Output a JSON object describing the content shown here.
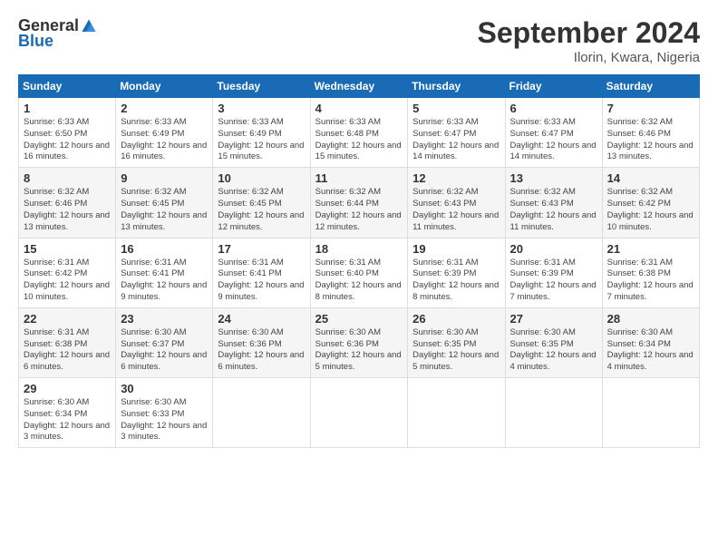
{
  "header": {
    "logo_general": "General",
    "logo_blue": "Blue",
    "title": "September 2024",
    "subtitle": "Ilorin, Kwara, Nigeria"
  },
  "weekdays": [
    "Sunday",
    "Monday",
    "Tuesday",
    "Wednesday",
    "Thursday",
    "Friday",
    "Saturday"
  ],
  "weeks": [
    [
      {
        "day": 1,
        "sunrise": "6:33 AM",
        "sunset": "6:50 PM",
        "daylight": "12 hours and 16 minutes."
      },
      {
        "day": 2,
        "sunrise": "6:33 AM",
        "sunset": "6:49 PM",
        "daylight": "12 hours and 16 minutes."
      },
      {
        "day": 3,
        "sunrise": "6:33 AM",
        "sunset": "6:49 PM",
        "daylight": "12 hours and 15 minutes."
      },
      {
        "day": 4,
        "sunrise": "6:33 AM",
        "sunset": "6:48 PM",
        "daylight": "12 hours and 15 minutes."
      },
      {
        "day": 5,
        "sunrise": "6:33 AM",
        "sunset": "6:47 PM",
        "daylight": "12 hours and 14 minutes."
      },
      {
        "day": 6,
        "sunrise": "6:33 AM",
        "sunset": "6:47 PM",
        "daylight": "12 hours and 14 minutes."
      },
      {
        "day": 7,
        "sunrise": "6:32 AM",
        "sunset": "6:46 PM",
        "daylight": "12 hours and 13 minutes."
      }
    ],
    [
      {
        "day": 8,
        "sunrise": "6:32 AM",
        "sunset": "6:46 PM",
        "daylight": "12 hours and 13 minutes."
      },
      {
        "day": 9,
        "sunrise": "6:32 AM",
        "sunset": "6:45 PM",
        "daylight": "12 hours and 13 minutes."
      },
      {
        "day": 10,
        "sunrise": "6:32 AM",
        "sunset": "6:45 PM",
        "daylight": "12 hours and 12 minutes."
      },
      {
        "day": 11,
        "sunrise": "6:32 AM",
        "sunset": "6:44 PM",
        "daylight": "12 hours and 12 minutes."
      },
      {
        "day": 12,
        "sunrise": "6:32 AM",
        "sunset": "6:43 PM",
        "daylight": "12 hours and 11 minutes."
      },
      {
        "day": 13,
        "sunrise": "6:32 AM",
        "sunset": "6:43 PM",
        "daylight": "12 hours and 11 minutes."
      },
      {
        "day": 14,
        "sunrise": "6:32 AM",
        "sunset": "6:42 PM",
        "daylight": "12 hours and 10 minutes."
      }
    ],
    [
      {
        "day": 15,
        "sunrise": "6:31 AM",
        "sunset": "6:42 PM",
        "daylight": "12 hours and 10 minutes."
      },
      {
        "day": 16,
        "sunrise": "6:31 AM",
        "sunset": "6:41 PM",
        "daylight": "12 hours and 9 minutes."
      },
      {
        "day": 17,
        "sunrise": "6:31 AM",
        "sunset": "6:41 PM",
        "daylight": "12 hours and 9 minutes."
      },
      {
        "day": 18,
        "sunrise": "6:31 AM",
        "sunset": "6:40 PM",
        "daylight": "12 hours and 8 minutes."
      },
      {
        "day": 19,
        "sunrise": "6:31 AM",
        "sunset": "6:39 PM",
        "daylight": "12 hours and 8 minutes."
      },
      {
        "day": 20,
        "sunrise": "6:31 AM",
        "sunset": "6:39 PM",
        "daylight": "12 hours and 7 minutes."
      },
      {
        "day": 21,
        "sunrise": "6:31 AM",
        "sunset": "6:38 PM",
        "daylight": "12 hours and 7 minutes."
      }
    ],
    [
      {
        "day": 22,
        "sunrise": "6:31 AM",
        "sunset": "6:38 PM",
        "daylight": "12 hours and 6 minutes."
      },
      {
        "day": 23,
        "sunrise": "6:30 AM",
        "sunset": "6:37 PM",
        "daylight": "12 hours and 6 minutes."
      },
      {
        "day": 24,
        "sunrise": "6:30 AM",
        "sunset": "6:36 PM",
        "daylight": "12 hours and 6 minutes."
      },
      {
        "day": 25,
        "sunrise": "6:30 AM",
        "sunset": "6:36 PM",
        "daylight": "12 hours and 5 minutes."
      },
      {
        "day": 26,
        "sunrise": "6:30 AM",
        "sunset": "6:35 PM",
        "daylight": "12 hours and 5 minutes."
      },
      {
        "day": 27,
        "sunrise": "6:30 AM",
        "sunset": "6:35 PM",
        "daylight": "12 hours and 4 minutes."
      },
      {
        "day": 28,
        "sunrise": "6:30 AM",
        "sunset": "6:34 PM",
        "daylight": "12 hours and 4 minutes."
      }
    ],
    [
      {
        "day": 29,
        "sunrise": "6:30 AM",
        "sunset": "6:34 PM",
        "daylight": "12 hours and 3 minutes."
      },
      {
        "day": 30,
        "sunrise": "6:30 AM",
        "sunset": "6:33 PM",
        "daylight": "12 hours and 3 minutes."
      },
      null,
      null,
      null,
      null,
      null
    ]
  ]
}
